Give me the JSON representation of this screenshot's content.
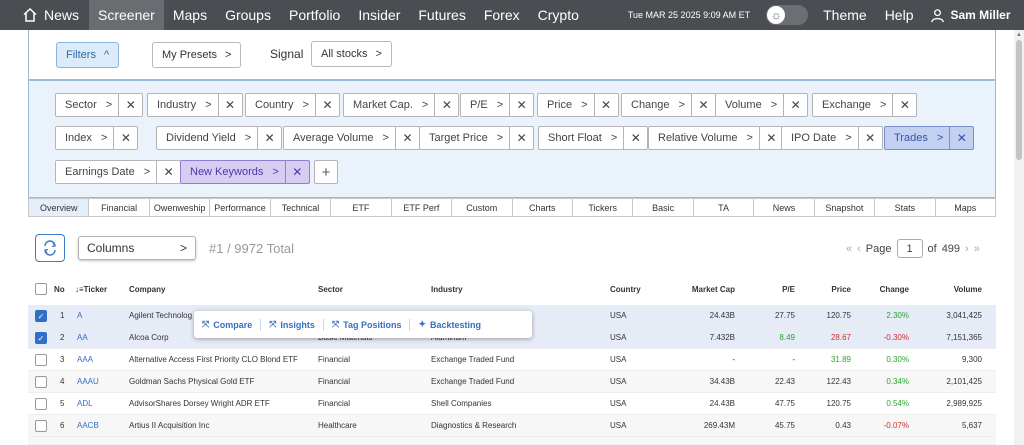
{
  "nav": {
    "home": "News",
    "items": [
      "Screener",
      "Maps",
      "Groups",
      "Portfolio",
      "Insider",
      "Futures",
      "Forex",
      "Crypto"
    ],
    "active": "Screener",
    "date": "Tue MAR 25 2025 9:09 AM ET",
    "theme": "Theme",
    "help": "Help",
    "user": "Sam Miller"
  },
  "top": {
    "filters": "Filters",
    "presets": "My Presets",
    "signal_label": "Signal",
    "signal_value": "All stocks"
  },
  "chips": [
    "Sector",
    "Industry",
    "Country",
    "Market Cap.",
    "P/E",
    "Price",
    "Change",
    "Volume",
    "Exchange",
    "Index",
    "Dividend Yield",
    "Average Volume",
    "Target Price",
    "Short Float",
    "Relative Volume",
    "IPO Date",
    "Trades",
    "Earnings Date",
    "New Keywords"
  ],
  "tabs": [
    "Overview",
    "Financial",
    "Owenweship",
    "Performance",
    "Technical",
    "ETF",
    "ETF Perf",
    "Custom",
    "Charts",
    "Tickers",
    "Basic",
    "TA",
    "News",
    "Snapshot",
    "Stats",
    "Maps"
  ],
  "toolbar": {
    "columns": "Columns",
    "total": "#1 / 9972 Total",
    "page_label": "Page",
    "page": "1",
    "of": "of",
    "pages": "499"
  },
  "columns": [
    "No",
    "Ticker",
    "Company",
    "Sector",
    "Industry",
    "Country",
    "Market Cap",
    "P/E",
    "Price",
    "Change",
    "Volume"
  ],
  "rows": [
    {
      "no": "1",
      "ticker": "A",
      "company": "Agilent Technolog",
      "sector": "",
      "industry": "",
      "country": "USA",
      "cap": "24.43B",
      "pe": "27.75",
      "price": "120.75",
      "change": "2.30%",
      "volume": "3,041,425"
    },
    {
      "no": "2",
      "ticker": "AA",
      "company": "Alcoa Corp",
      "sector": "Basic Materials",
      "industry": "Aluminum",
      "country": "USA",
      "cap": "7.432B",
      "pe": "8.49",
      "price": "28.67",
      "change": "-0.30%",
      "volume": "7,151,365"
    },
    {
      "no": "3",
      "ticker": "AAA",
      "company": "Alternative Access First Priority CLO Blond ETF",
      "sector": "Financial",
      "industry": "Exchange Traded Fund",
      "country": "USA",
      "cap": "-",
      "pe": "-",
      "price": "31.89",
      "change": "0.30%",
      "volume": "9,300"
    },
    {
      "no": "4",
      "ticker": "AAAU",
      "company": "Goldman Sachs Physical Gold ETF",
      "sector": "Financial",
      "industry": "Exchange Traded Fund",
      "country": "USA",
      "cap": "34.43B",
      "pe": "22.43",
      "price": "122.43",
      "change": "0.34%",
      "volume": "2,101,425"
    },
    {
      "no": "5",
      "ticker": "ADL",
      "company": "AdvisorShares Dorsey Wright ADR ETF",
      "sector": "Financial",
      "industry": "Shell Companies",
      "country": "USA",
      "cap": "24.43B",
      "pe": "47.75",
      "price": "120.75",
      "change": "0.54%",
      "volume": "2,989,925"
    },
    {
      "no": "6",
      "ticker": "AACB",
      "company": "Artius II Acquisition Inc",
      "sector": "Healthcare",
      "industry": "Diagnostics & Research",
      "country": "USA",
      "cap": "269.43M",
      "pe": "45.75",
      "price": "0.43",
      "change": "-0.07%",
      "volume": "5,637"
    }
  ],
  "popup": [
    "Compare",
    "Insights",
    "Tag Positions",
    "Backtesting"
  ]
}
